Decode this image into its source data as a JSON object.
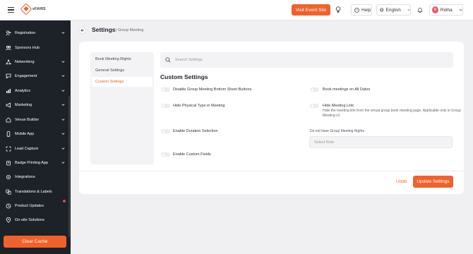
{
  "topbar": {
    "logo_text": "vFAIRS",
    "visit_label": "Visit Event Site",
    "help_label": "Help",
    "language_label": "English",
    "user_name": "Ridha",
    "user_initial": "R"
  },
  "sidebar": {
    "items": [
      {
        "label": "Registration",
        "icon": "user-plus-icon",
        "has_chevron": true
      },
      {
        "label": "Sponsors Hub",
        "icon": "people-icon",
        "has_chevron": false
      },
      {
        "label": "Networking",
        "icon": "network-icon",
        "has_chevron": true
      },
      {
        "label": "Engagement",
        "icon": "engagement-icon",
        "has_chevron": true
      },
      {
        "label": "Analytics",
        "icon": "analytics-icon",
        "has_chevron": true
      },
      {
        "label": "Marketing",
        "icon": "megaphone-icon",
        "has_chevron": true
      },
      {
        "label": "Venue Builder",
        "icon": "builder-icon",
        "has_chevron": true
      },
      {
        "label": "Mobile App",
        "icon": "mobile-icon",
        "has_chevron": true
      },
      {
        "label": "Lead Capture",
        "icon": "lead-icon",
        "has_chevron": true
      },
      {
        "label": "Badge Printing App",
        "icon": "badge-icon",
        "has_chevron": true
      },
      {
        "label": "Integrations",
        "icon": "integrations-icon",
        "has_chevron": false
      },
      {
        "label": "Translations & Labels",
        "icon": "translate-icon",
        "has_chevron": false
      },
      {
        "label": "Product Updates",
        "icon": "updates-icon",
        "has_chevron": false
      },
      {
        "label": "On-site Solutions",
        "icon": "location-icon",
        "has_chevron": false
      }
    ],
    "clear_cache_label": "Clear Cache"
  },
  "header": {
    "title": "Settings",
    "breadcrumb": "Group Meeting"
  },
  "settings_nav": [
    {
      "label": "Book Meeting Rights",
      "active": false
    },
    {
      "label": "General Settings",
      "active": false
    },
    {
      "label": "Custom Settings",
      "active": true
    }
  ],
  "search": {
    "placeholder": "Search Settings"
  },
  "section": {
    "title": "Custom Settings"
  },
  "options": {
    "disable_bottom_sheet": {
      "label": "Disable Group Meeting Bottom Sheet Buttons",
      "enabled": false
    },
    "hide_physical_type": {
      "label": "Hide Physical Type in Meeting",
      "enabled": false
    },
    "enable_duration": {
      "label": "Enable Duration Selection",
      "enabled": false
    },
    "enable_custom_fields": {
      "label": "Enable Custom Fields",
      "enabled": false
    },
    "book_all_dates": {
      "label": "Book meetings on All Dates",
      "enabled": false
    },
    "hide_meeting_link": {
      "label": "Hide Meeting Link",
      "description": "Hide the meeting link from the virtual group book meeting page. Applicable only in Group Meeting v1",
      "enabled": false
    }
  },
  "no_rights": {
    "label": "Do not have Group Meeting Rights",
    "placeholder": "Select Role"
  },
  "footer": {
    "undo_label": "Undo",
    "update_label": "Update Settings"
  },
  "colors": {
    "accent": "#f0622c",
    "sidebar_bg": "#1d2128",
    "page_bg": "#f0f0f3"
  }
}
